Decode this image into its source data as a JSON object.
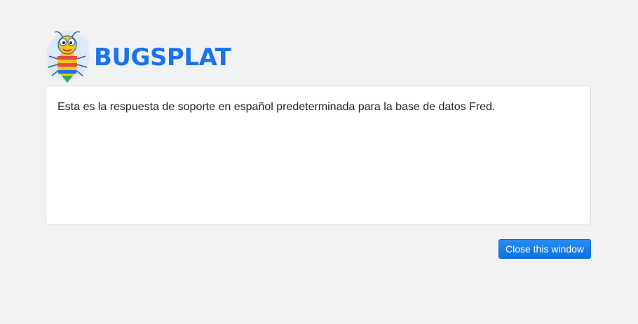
{
  "brand": {
    "name": "BUGSPLAT",
    "logo_icon": "bug-mascot-icon",
    "color": "#1a73e8"
  },
  "message": {
    "text": "Esta es la respuesta de soporte en español predeterminada para la base de datos Fred."
  },
  "actions": {
    "close_label": "Close this window",
    "close_color": "#0a72e0"
  },
  "page": {
    "background": "#f1f2f4"
  }
}
